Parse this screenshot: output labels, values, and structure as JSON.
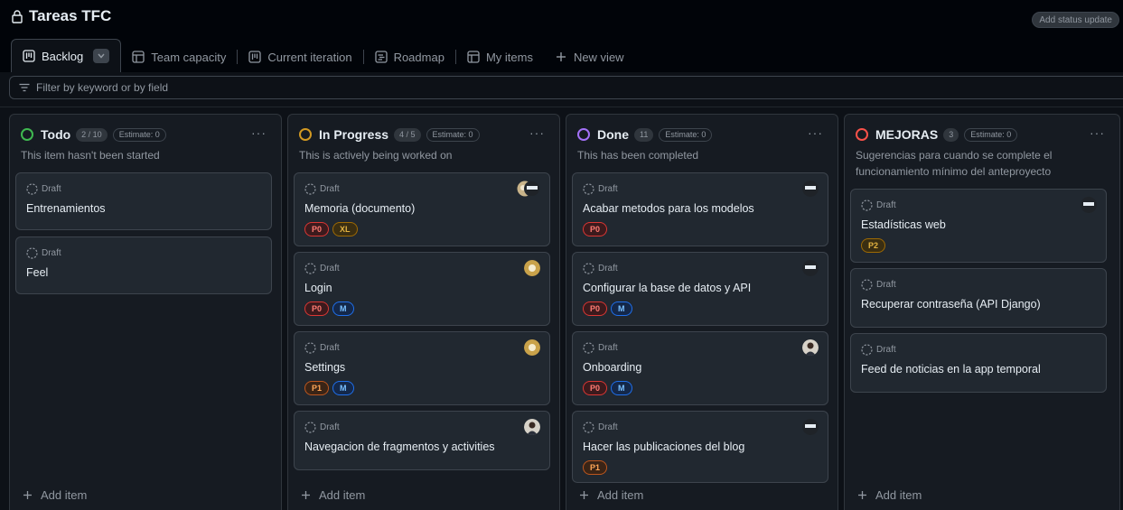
{
  "header": {
    "title": "Tareas TFC",
    "status_button": "Add status update"
  },
  "tabs": [
    {
      "label": "Backlog",
      "icon": "board-icon",
      "active": true
    },
    {
      "label": "Team capacity",
      "icon": "table-icon"
    },
    {
      "label": "Current iteration",
      "icon": "board-icon"
    },
    {
      "label": "Roadmap",
      "icon": "roadmap-icon"
    },
    {
      "label": "My items",
      "icon": "table-icon"
    },
    {
      "label": "New view",
      "icon": "plus-icon"
    }
  ],
  "filter": {
    "placeholder": "Filter by keyword or by field"
  },
  "columns": [
    {
      "title": "Todo",
      "count": "2 / 10",
      "estimate": "Estimate: 0",
      "description": "This item hasn't been started",
      "status_color": "#3fb950",
      "cards": [
        {
          "draft": "Draft",
          "title": "Entrenamientos"
        },
        {
          "draft": "Draft",
          "title": "Feel"
        }
      ],
      "add_item": "Add item"
    },
    {
      "title": "In Progress",
      "count": "4 / 5",
      "estimate": "Estimate: 0",
      "description": "This is actively being worked on",
      "status_color": "#d29922",
      "cards": [
        {
          "draft": "Draft",
          "title": "Memoria (documento)",
          "labels": [
            "P0",
            "XL"
          ]
        },
        {
          "draft": "Draft",
          "title": "Login",
          "labels": [
            "P0",
            "M"
          ]
        },
        {
          "draft": "Draft",
          "title": "Settings",
          "labels": [
            "P1",
            "M"
          ]
        },
        {
          "draft": "Draft",
          "title": "Navegacion de fragmentos y activities"
        }
      ],
      "add_item": "Add item"
    },
    {
      "title": "Done",
      "count": "11",
      "estimate": "Estimate: 0",
      "description": "This has been completed",
      "status_color": "#a371f7",
      "cards": [
        {
          "draft": "Draft",
          "title": "Acabar metodos para los modelos",
          "labels": [
            "P0"
          ]
        },
        {
          "draft": "Draft",
          "title": "Configurar la base de datos y API",
          "labels": [
            "P0",
            "M"
          ]
        },
        {
          "draft": "Draft",
          "title": "Onboarding",
          "labels": [
            "P0",
            "M"
          ]
        },
        {
          "draft": "Draft",
          "title": "Hacer las publicaciones del blog",
          "labels": [
            "P1"
          ]
        }
      ],
      "add_item": "Add item"
    },
    {
      "title": "MEJORAS",
      "count": "3",
      "estimate": "Estimate: 0",
      "description": "Sugerencias para cuando se complete el funcionamiento mínimo del anteproyecto",
      "status_color": "#f85149",
      "cards": [
        {
          "draft": "Draft",
          "title": "Estadísticas web",
          "labels": [
            "P2"
          ]
        },
        {
          "draft": "Draft",
          "title": "Recuperar contraseña (API Django)"
        },
        {
          "draft": "Draft",
          "title": "Feed de noticias en la app temporal"
        }
      ],
      "add_item": "Add item"
    }
  ],
  "label_colors": {
    "P0": {
      "text": "#ff7b72",
      "border": "#da3633",
      "bg": "#3c1a1d"
    },
    "P1": {
      "text": "#ffa657",
      "border": "#bd561d",
      "bg": "#3a2416"
    },
    "P2": {
      "text": "#e3b341",
      "border": "#9e6a03",
      "bg": "#3a2e12"
    },
    "XL": {
      "text": "#e3b341",
      "border": "#9e6a03",
      "bg": "#3a2e12"
    },
    "M": {
      "text": "#79c0ff",
      "border": "#1f6feb",
      "bg": "#14284a"
    }
  }
}
